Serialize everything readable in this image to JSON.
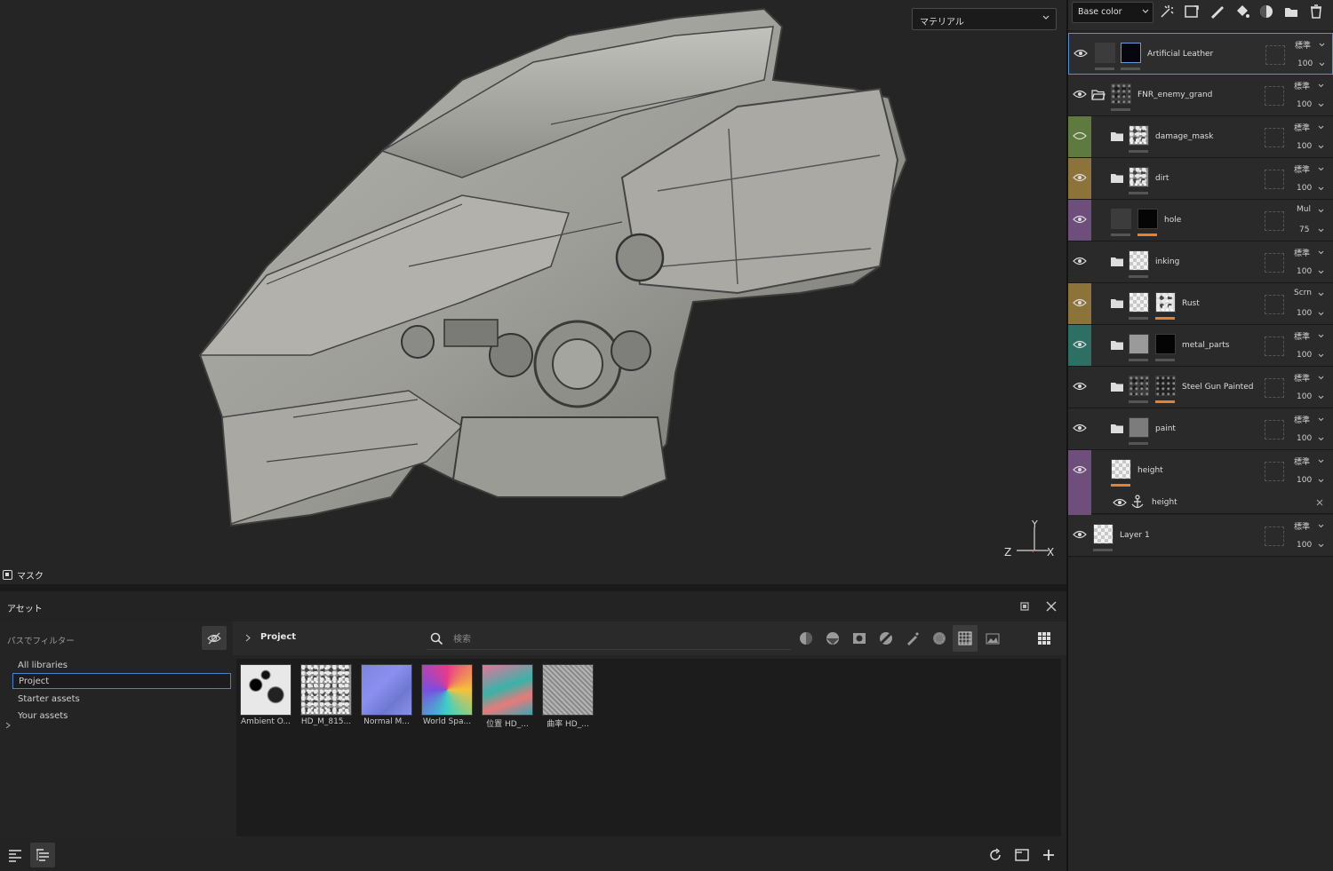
{
  "viewport": {
    "mode_dropdown": "マテリアル",
    "mask_label": "マスク",
    "gizmo": {
      "y": "Y",
      "z": "Z",
      "x": "X"
    }
  },
  "assets": {
    "title": "アセット",
    "filter_label": "パスでフィルター",
    "libraries": [
      {
        "label": "All libraries"
      },
      {
        "label": "Project"
      },
      {
        "label": "Starter assets"
      },
      {
        "label": "Your assets"
      }
    ],
    "breadcrumb": "Project",
    "search": {
      "placeholder": "検索",
      "value": ""
    },
    "thumbnails": [
      {
        "label": "Ambient O..."
      },
      {
        "label": "HD_M_815..."
      },
      {
        "label": "Normal M..."
      },
      {
        "label": "World Spa..."
      },
      {
        "label": "位置 HD_..."
      },
      {
        "label": "曲率 HD_..."
      }
    ]
  },
  "layers_panel": {
    "channel": "Base color",
    "accent_colors": {
      "selection": "#5d8fd6",
      "olive": "#8b7339",
      "purple": "#6e4f7b",
      "teal": "#2d7063",
      "green": "#5f7a3e",
      "orange": "#e8812f"
    },
    "layers": [
      {
        "name": "Artificial Leather",
        "blend": "標準",
        "opacity": "100"
      },
      {
        "name": "FNR_enemy_grand",
        "blend": "標準",
        "opacity": "100"
      },
      {
        "name": "damage_mask",
        "blend": "標準",
        "opacity": "100"
      },
      {
        "name": "dirt",
        "blend": "標準",
        "opacity": "100"
      },
      {
        "name": "hole",
        "blend": "Mul",
        "opacity": "75"
      },
      {
        "name": "inking",
        "blend": "標準",
        "opacity": "100"
      },
      {
        "name": "Rust",
        "blend": "Scrn",
        "opacity": "100"
      },
      {
        "name": "metal_parts",
        "blend": "標準",
        "opacity": "100"
      },
      {
        "name": "Steel Gun Painted",
        "blend": "標準",
        "opacity": "100"
      },
      {
        "name": "paint",
        "blend": "標準",
        "opacity": "100"
      },
      {
        "name": "height",
        "blend": "標準",
        "opacity": "100"
      },
      {
        "name": "Layer 1",
        "blend": "標準",
        "opacity": "100"
      }
    ],
    "anchor": {
      "name": "height"
    }
  }
}
